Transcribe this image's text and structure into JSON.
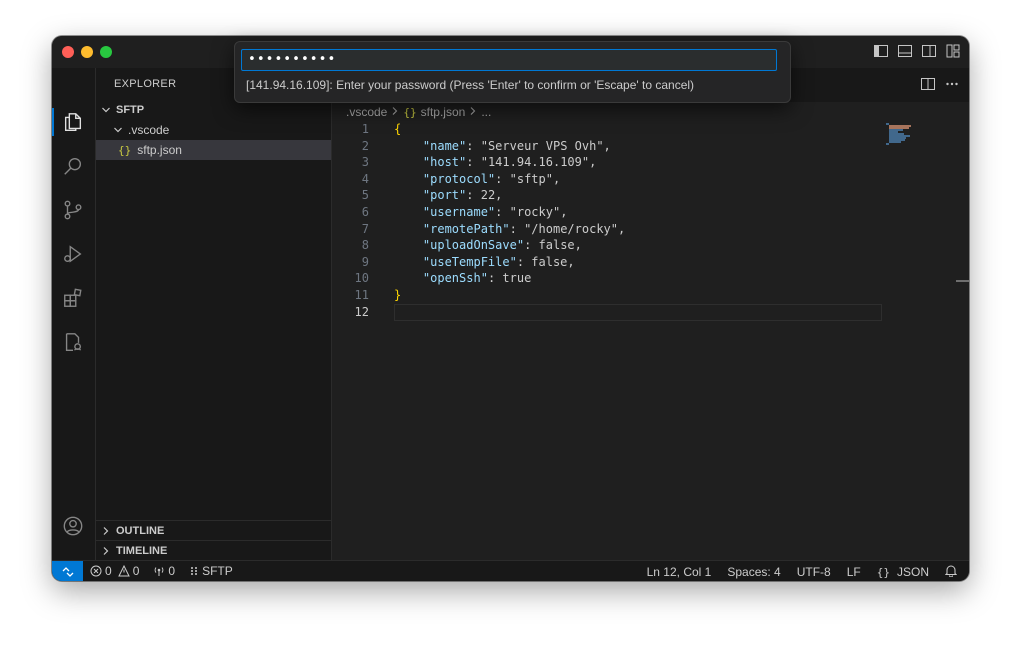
{
  "activity_bar": {
    "items": [
      "explorer-icon",
      "search-icon",
      "source-control-icon",
      "run-debug-icon",
      "extensions-icon",
      "remote-explorer-icon"
    ],
    "bottom": [
      "account-icon",
      "settings-icon"
    ]
  },
  "sidebar": {
    "title": "EXPLORER",
    "root": "SFTP",
    "folder": ".vscode",
    "file_icon": "{}",
    "file": "sftp.json",
    "sections": [
      "OUTLINE",
      "TIMELINE"
    ]
  },
  "breadcrumb": {
    "folder": ".vscode",
    "file_icon": "{}",
    "file": "sftp.json",
    "tail": "..."
  },
  "code": {
    "current_line": 12,
    "lines": [
      {
        "n": "1",
        "text": "{"
      },
      {
        "n": "2",
        "text": "    \"name\": \"Serveur VPS Ovh\","
      },
      {
        "n": "3",
        "text": "    \"host\": \"141.94.16.109\","
      },
      {
        "n": "4",
        "text": "    \"protocol\": \"sftp\","
      },
      {
        "n": "5",
        "text": "    \"port\": 22,"
      },
      {
        "n": "6",
        "text": "    \"username\": \"rocky\","
      },
      {
        "n": "7",
        "text": "    \"remotePath\": \"/home/rocky\","
      },
      {
        "n": "8",
        "text": "    \"uploadOnSave\": false,"
      },
      {
        "n": "9",
        "text": "    \"useTempFile\": false,"
      },
      {
        "n": "10",
        "text": "    \"openSsh\": true"
      },
      {
        "n": "11",
        "text": "}"
      },
      {
        "n": "12",
        "text": ""
      }
    ]
  },
  "quick_input": {
    "value": "••••••••••",
    "message": "[141.94.16.109]: Enter your password (Press 'Enter' to confirm or 'Escape' to cancel)"
  },
  "status_bar": {
    "errors": "0",
    "warnings": "0",
    "ports": "0",
    "project": "SFTP",
    "position": "Ln 12, Col 1",
    "spaces": "Spaces: 4",
    "encoding": "UTF-8",
    "eol": "LF",
    "language_icon": "{}",
    "language": "JSON"
  },
  "colors": {
    "accent": "#0078d4",
    "key": "#9cdcfe",
    "string": "#ce9178",
    "number": "#b5cea8",
    "boolean": "#569cd6",
    "bracket": "#ffd700"
  }
}
